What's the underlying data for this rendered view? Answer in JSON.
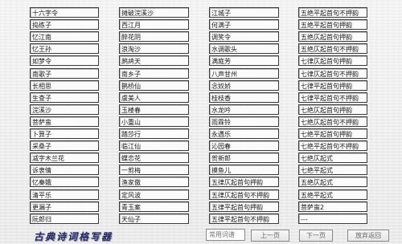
{
  "table": {
    "rows": [
      [
        "十六字令",
        "摊破浣溪沙",
        "江城子",
        "五绝平起首句不押韵"
      ],
      [
        "捣练子",
        "西江月",
        "何满子",
        "五绝平起首句押韵"
      ],
      [
        "忆江南",
        "醉花阴",
        "调笑令",
        "五绝仄起首句押韵"
      ],
      [
        "忆王孙",
        "浪淘沙",
        "水调歌头",
        "五绝仄起首句不押韵"
      ],
      [
        "如梦令",
        "鹧鸪天",
        "满庭芳",
        "七律仄起首句押韵"
      ],
      [
        "南歌子",
        "南乡子",
        "八声甘州",
        "七律仄起首句不押韵"
      ],
      [
        "长相思",
        "鹊桥仙",
        "念奴娇",
        "七律平起首句押韵"
      ],
      [
        "生查子",
        "虞美人",
        "桂枝香",
        "七律平起首句不押韵"
      ],
      [
        "浣溪沙",
        "玉楼春",
        "水龙吟",
        "七绝仄起首句押韵"
      ],
      [
        "菩萨蛮",
        "小重山",
        "雨霖铃",
        "七绝仄起首句不押韵"
      ],
      [
        "卜算子",
        "踏莎行",
        "永遇乐",
        "七绝平起首句押韵"
      ],
      [
        "采桑子",
        "临江仙",
        "沁园春",
        "七绝平起首句不押韵"
      ],
      [
        "减字木兰花",
        "蝶恋花",
        "贺新郎",
        "七绝仄起式"
      ],
      [
        "诉衷情",
        "一剪梅",
        "摸鱼儿",
        "七绝平起式"
      ],
      [
        "忆秦娥",
        "渔家傲",
        "五律仄起首句押韵",
        "五绝仄起式"
      ],
      [
        "清平乐",
        "定风波",
        "五律仄起首句不押韵",
        "五绝平起式"
      ],
      [
        "更漏子",
        "青玉案",
        "五律平起首句押韵",
        "菩萨蛮2"
      ],
      [
        "阮郎归",
        "天仙子",
        "五律平起首句不押韵",
        "---"
      ]
    ]
  },
  "footer": {
    "logo_text": "古典诗词格写器",
    "search_placeholder": "常用词谱",
    "prev_button": "上一页",
    "next_button": "下一页",
    "quit_button": "放弃返回"
  },
  "colors": {
    "cell_border": "#3a3a3a",
    "background": "#f0f0f0",
    "logo": "#2a2a5a"
  }
}
